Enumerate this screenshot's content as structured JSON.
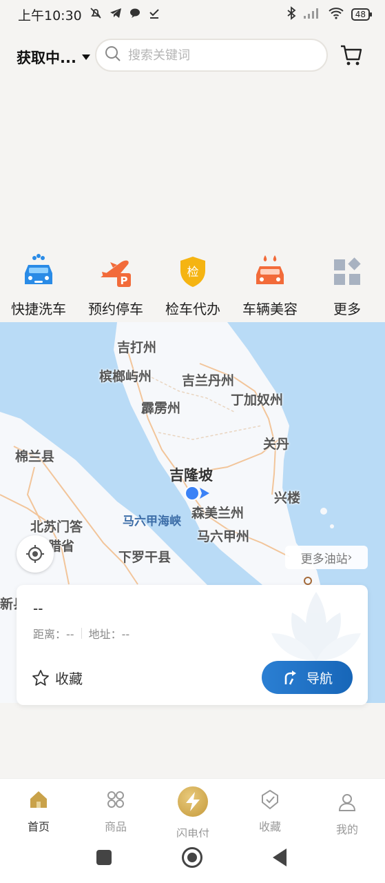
{
  "status_bar": {
    "time": "上午10:30",
    "battery": "48",
    "left_icons": [
      "mute-bell-icon",
      "telegram-icon",
      "chat-icon",
      "download-check-icon"
    ],
    "right_icons": [
      "bluetooth-icon",
      "signal-icon",
      "wifi-icon",
      "battery-icon"
    ]
  },
  "header": {
    "location": "获取中...",
    "search_placeholder": "搜索关键词"
  },
  "services": [
    {
      "label": "快捷洗车",
      "icon": "car-wash-icon"
    },
    {
      "label": "预约停车",
      "icon": "parking-icon"
    },
    {
      "label": "检车代办",
      "icon": "inspection-icon"
    },
    {
      "label": "车辆美容",
      "icon": "car-beauty-icon"
    },
    {
      "label": "更多",
      "icon": "more-grid-icon"
    }
  ],
  "map": {
    "places": {
      "kedah": "吉打州",
      "penang": "槟榔屿州",
      "kelantan": "吉兰丹州",
      "terengganu": "丁加奴州",
      "perak": "霹雳州",
      "kuantan": "关丹",
      "medan": "棉兰县",
      "kl": "吉隆坡",
      "xinglou": "兴楼",
      "strait": "马六甲海峡",
      "negeri": "森美兰州",
      "sumatra_n": "北苏门答",
      "sumatra_n2": "腊省",
      "melaka": "马六甲州",
      "lower_luogan": "下罗干县",
      "xin": "新县"
    },
    "more_stations": "更多油站"
  },
  "station_card": {
    "name": "--",
    "distance_label": "距离：--",
    "address_label": "地址：--",
    "favorite_label": "收藏",
    "navigate_label": "导航"
  },
  "tabbar": {
    "home": "首页",
    "goods": "商品",
    "flash_pay": "闪电付",
    "favorites": "收藏",
    "mine": "我的"
  },
  "colors": {
    "accent_gold": "#c9a24a",
    "nav_blue": "#1f72c6",
    "map_sea": "#b9dbf6"
  }
}
